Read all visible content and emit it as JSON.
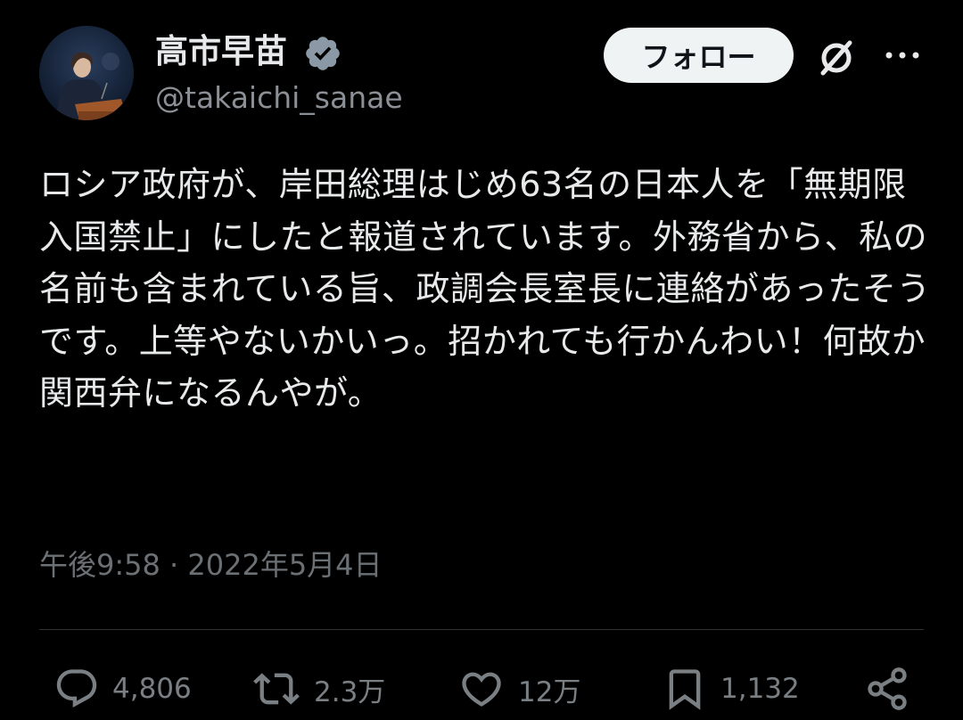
{
  "colors": {
    "background": "#000000",
    "primary_text": "#e7e9ea",
    "secondary_text": "#6b7075",
    "verified_badge": "#8b98a5",
    "follow_button_bg": "#eff3f4",
    "divider": "#2f3336"
  },
  "author": {
    "display_name": "高市早苗",
    "handle": "@takaichi_sanae",
    "verified_icon": "verified-badge-icon",
    "avatar_icon": "avatar"
  },
  "header": {
    "follow_label": "フォロー",
    "grok_icon": "grok-icon",
    "more_icon": "more-horizontal-icon"
  },
  "tweet": {
    "text": "ロシア政府が、岸田総理はじめ63名の日本人を「無期限入国禁止」にしたと報道されています。外務省から、私の名前も含まれている旨、政調会長室長に連絡があったそうです。上等やないかいっ。招かれても行かんわい！何故か関西弁になるんやが。",
    "timestamp": "午後9:58 · 2022年5月4日"
  },
  "actions": {
    "reply": {
      "icon": "reply-icon",
      "count": "4,806"
    },
    "repost": {
      "icon": "repost-icon",
      "count": "2.3万"
    },
    "like": {
      "icon": "heart-icon",
      "count": "12万"
    },
    "bookmark": {
      "icon": "bookmark-icon",
      "count": "1,132"
    },
    "share": {
      "icon": "share-icon"
    }
  }
}
